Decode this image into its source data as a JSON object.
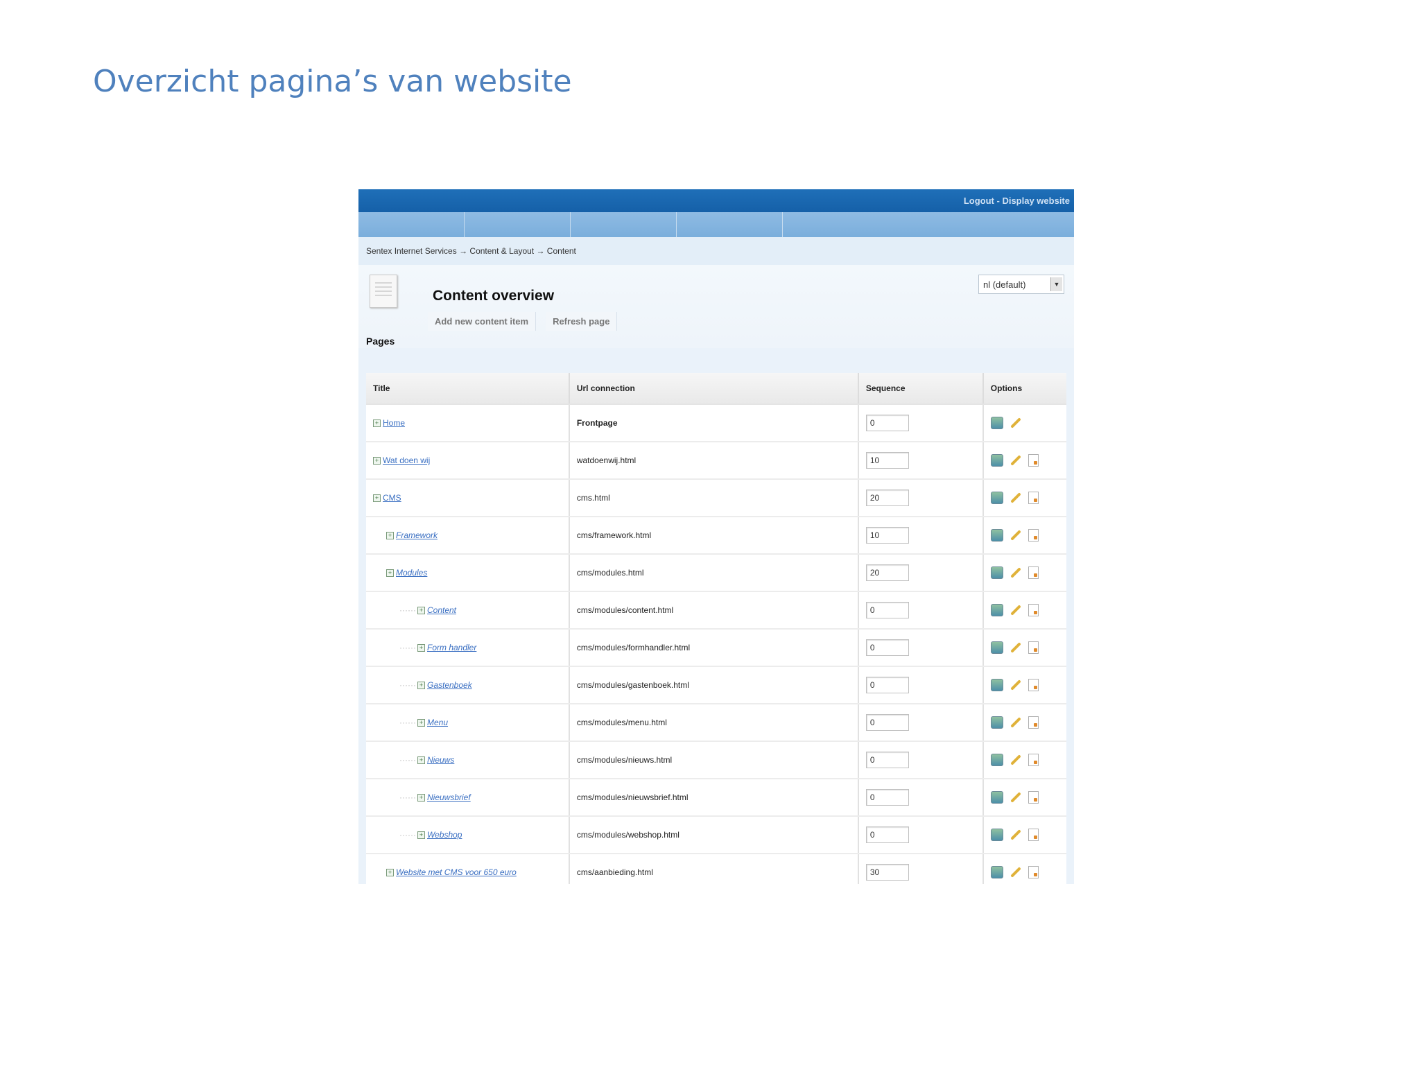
{
  "slide": {
    "title": "Overzicht pagina’s van website"
  },
  "cms": {
    "topbar": {
      "logout": "Logout",
      "separator": " - ",
      "display": "Display website"
    },
    "breadcrumb": "Sentex Internet Services → Content & Layout → Content",
    "overview_title": "Content overview",
    "actions": {
      "add": "Add new content item",
      "refresh": "Refresh page"
    },
    "language_select": "nl (default)",
    "pages_label": "Pages",
    "columns": {
      "title": "Title",
      "url": "Url connection",
      "sequence": "Sequence",
      "options": "Options"
    },
    "rows": [
      {
        "title": "Home",
        "url": "Frontpage",
        "sequence": "0"
      },
      {
        "title": "Wat doen wij",
        "url": "watdoenwij.html",
        "sequence": "10"
      },
      {
        "title": "CMS",
        "url": "cms.html",
        "sequence": "20"
      },
      {
        "title": "Framework",
        "url": "cms/framework.html",
        "sequence": "10"
      },
      {
        "title": "Modules",
        "url": "cms/modules.html",
        "sequence": "20"
      },
      {
        "title": "Content",
        "url": "cms/modules/content.html",
        "sequence": "0"
      },
      {
        "title": "Form handler",
        "url": "cms/modules/formhandler.html",
        "sequence": "0"
      },
      {
        "title": "Gastenboek",
        "url": "cms/modules/gastenboek.html",
        "sequence": "0"
      },
      {
        "title": "Menu",
        "url": "cms/modules/menu.html",
        "sequence": "0"
      },
      {
        "title": "Nieuws",
        "url": "cms/modules/nieuws.html",
        "sequence": "0"
      },
      {
        "title": "Nieuwsbrief",
        "url": "cms/modules/nieuwsbrief.html",
        "sequence": "0"
      },
      {
        "title": "Webshop",
        "url": "cms/modules/webshop.html",
        "sequence": "0"
      },
      {
        "title": "Website met CMS voor 650 euro",
        "url": "cms/aanbieding.html",
        "sequence": "30"
      }
    ],
    "icons": {
      "view": "preview-icon",
      "edit": "pencil-icon",
      "delete": "delete-page-icon",
      "expand": "tree-plus-icon",
      "document": "document-icon"
    }
  }
}
